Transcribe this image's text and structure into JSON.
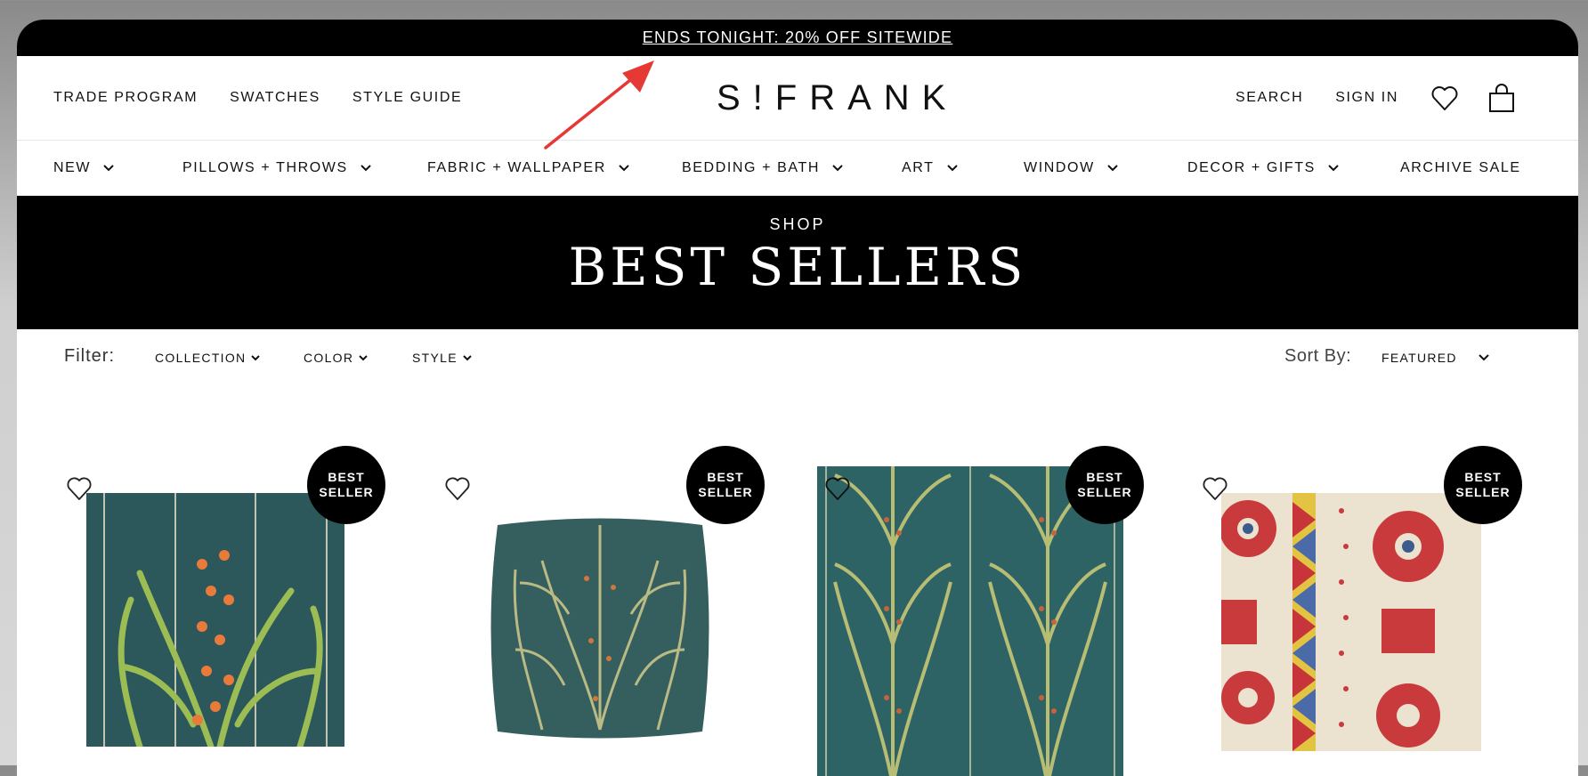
{
  "announcement": {
    "text": "ENDS TONIGHT: 20% OFF SITEWIDE"
  },
  "header": {
    "left_links": [
      "TRADE PROGRAM",
      "SWATCHES",
      "STYLE GUIDE"
    ],
    "logo": "S!FRANK",
    "right_links": [
      "SEARCH",
      "SIGN IN"
    ]
  },
  "nav": {
    "items": [
      {
        "label": "NEW"
      },
      {
        "label": "PILLOWS + THROWS"
      },
      {
        "label": "FABRIC + WALLPAPER"
      },
      {
        "label": "BEDDING + BATH"
      },
      {
        "label": "ART"
      },
      {
        "label": "WINDOW"
      },
      {
        "label": "DECOR + GIFTS"
      },
      {
        "label": "ARCHIVE SALE"
      }
    ]
  },
  "hero": {
    "kicker": "SHOP",
    "title": "BEST SELLERS"
  },
  "filters": {
    "label": "Filter:",
    "options": [
      "COLLECTION",
      "COLOR",
      "STYLE"
    ],
    "sort_label": "Sort By:",
    "sort_value": "FEATURED"
  },
  "products": [
    {
      "badge_line1": "BEST",
      "badge_line2": "SELLER"
    },
    {
      "badge_line1": "BEST",
      "badge_line2": "SELLER"
    },
    {
      "badge_line1": "BEST",
      "badge_line2": "SELLER"
    },
    {
      "badge_line1": "BEST",
      "badge_line2": "SELLER"
    }
  ],
  "colors": {
    "accent": "#000000",
    "annotation_arrow": "#e53935"
  },
  "icons": [
    "heart-icon",
    "bag-icon",
    "chevron-down-icon"
  ]
}
